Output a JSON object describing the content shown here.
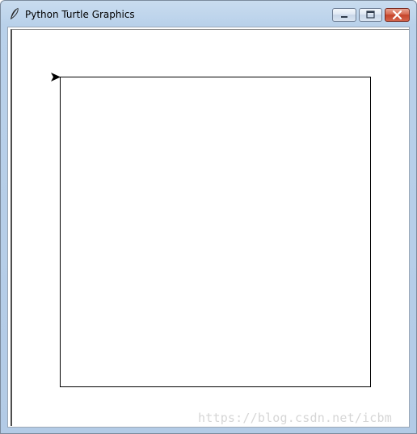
{
  "window": {
    "title": "Python Turtle Graphics",
    "app_icon": "feather-quill-icon",
    "buttons": {
      "minimize": "minimize-icon",
      "maximize": "maximize-icon",
      "close": "close-icon"
    },
    "close_color": "#c5432a"
  },
  "canvas": {
    "background": "#ffffff",
    "pen_color": "#000000",
    "shape": "square",
    "turtle": {
      "shape": "arrow",
      "heading": "east",
      "color": "#000000"
    }
  },
  "watermark": {
    "text": "https://blog.csdn.net/icbm"
  }
}
